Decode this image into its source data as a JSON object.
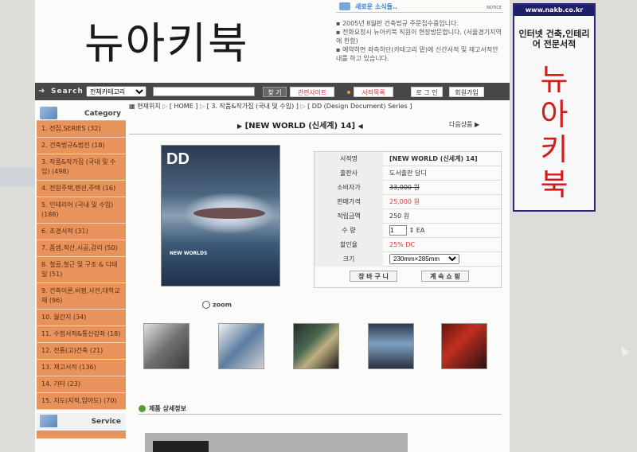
{
  "logo": "뉴아키북",
  "notice": {
    "title": "새로운 소식들..",
    "tag": "NOTICE",
    "items": [
      "2005년 8월판 건축법규 주문접수중입니다.",
      "전화요청시 뉴아키북 직원이 현장방문합니다. (서울경기지역에 한함)",
      "예약하면 좌측하단(카테고리 밑)에 신간서적 및 재고서적안내를 하고 있습니다."
    ]
  },
  "search": {
    "label": "Search",
    "category": "전체카테고리",
    "find": "찾 기",
    "related": "관련사이트",
    "booklist": "서적목록",
    "login": "로 그 인",
    "join": "회원가입"
  },
  "sidebar": {
    "category_title": "Category",
    "items": [
      "1. 전집,SERIES (32)",
      "2. 건축법규&법전 (18)",
      "3. 작품&작가집 (국내 및 수입) (498)",
      "4. 전원주택,펜션,주택 (16)",
      "5. 인테리어 (국내 및 수입) (188)",
      "6. 조경서적 (31)",
      "7. 품셈,적산,시공,감리 (50)",
      "8. 철골,철근 및 구조 & 디테일 (51)",
      "9. 건축이론,비평,사전,대학교재 (96)",
      "10. 월간지 (34)",
      "11. 수험서적&통신강좌 (18)",
      "12. 전통(고)건축 (21)",
      "13. 재고서적 (136)",
      "14. 기타 (23)",
      "15. 지도(지적,임야도) (70)"
    ],
    "service_title": "Service"
  },
  "breadcrumb": {
    "current": "현재위치",
    "home": "[ HOME ]",
    "cat": "[ 3. 작품&작가집 (국내 및 수입) ]",
    "series": "[ DD (Design Document) Series ]"
  },
  "product": {
    "title": "[NEW WORLD (신세계) 14]",
    "next": "다음상품",
    "cover_logo": "DD",
    "cover_title": "NEW WORLDS",
    "watermark": "www.nakb.co.kr",
    "zoom": "zoom",
    "fields": {
      "name_k": "서적명",
      "name_v": "[NEW WORLD (신세계) 14]",
      "pub_k": "출판사",
      "pub_v": "도서출판 담디",
      "list_k": "소비자가",
      "list_v": "33,000 원",
      "sale_k": "판매가격",
      "sale_v": "25,000 원",
      "pt_k": "적립금액",
      "pt_v": "250 원",
      "qty_k": "수 량",
      "qty_v": "1",
      "qty_unit": "EA",
      "disc_k": "할인율",
      "disc_v": "25% DC",
      "size_k": "크기",
      "size_v": "230mm×285mm"
    },
    "cart": "장 바 구 니",
    "continue": "계 속 쇼 핑",
    "detail": "제품 상세정보"
  },
  "banner": {
    "url": "www.nakb.co.kr",
    "desc": "인터넷 건축,인테리어 전문서적",
    "big": [
      "뉴",
      "아",
      "키",
      "북"
    ]
  }
}
